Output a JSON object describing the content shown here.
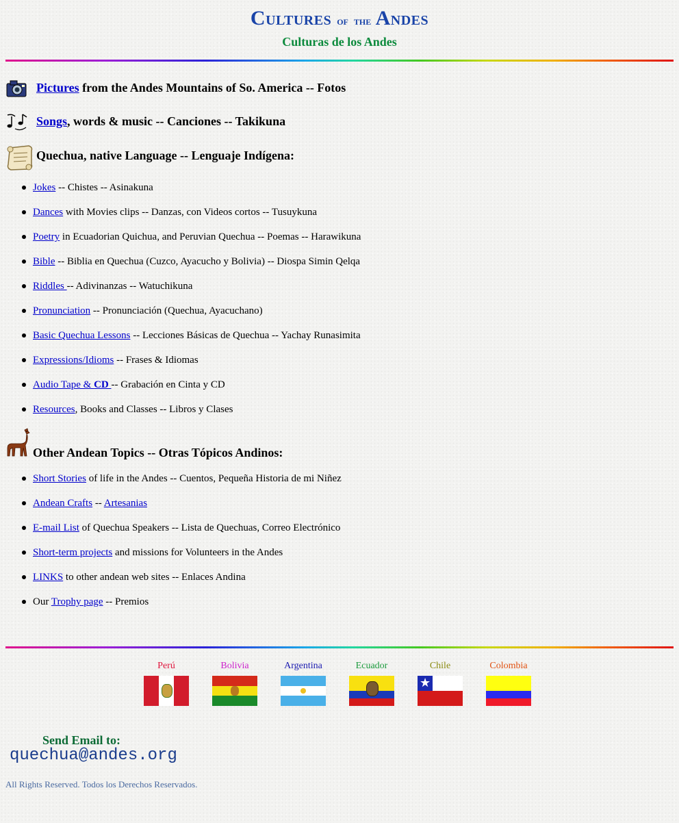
{
  "header": {
    "title_c": "C",
    "title_ultures": "ULTURES",
    "title_of": "OF",
    "title_the": "THE",
    "title_a": "A",
    "title_ndes": "NDES",
    "subtitle": "Culturas de los Andes"
  },
  "main_links": {
    "pictures": {
      "link": "Pictures",
      "text": " from the Andes Mountains of So. America -- Fotos"
    },
    "songs": {
      "link": "Songs",
      "text": ", words & music -- Canciones -- Takikuna"
    },
    "quechua_heading": "Quechua, native Language -- Lenguaje Indígena:"
  },
  "quechua_items": [
    {
      "link": "Jokes",
      "text": " -- Chistes -- Asinakuna"
    },
    {
      "link": "Dances",
      "text": " with Movies clips -- Danzas, con Videos cortos -- Tusuykuna"
    },
    {
      "link": "Poetry",
      "text": " in Ecuadorian Quichua, and Peruvian Quechua -- Poemas -- Harawikuna"
    },
    {
      "link": "Bible",
      "text": " -- Biblia en Quechua (Cuzco, Ayacucho y Bolivia) -- Diospa Simin Qelqa"
    },
    {
      "link": "Riddles ",
      "text": "-- Adivinanzas -- Watuchikuna"
    },
    {
      "link": "Pronunciation",
      "text": " -- Pronunciación (Quechua, Ayacuchano)"
    },
    {
      "link": "Basic Quechua Lessons",
      "text": " -- Lecciones Básicas de Quechua -- Yachay Runasimita"
    },
    {
      "link": "Expressions/Idioms",
      "text": " -- Frases & Idiomas"
    },
    {
      "link": "Audio Tape & ",
      "link_bold": "CD ",
      "text": "-- Grabación en Cinta y CD"
    },
    {
      "link": "Resources",
      "text": ", Books and Classes -- Libros y Clases"
    }
  ],
  "other_heading": "Other Andean Topics -- Otras Tópicos Andinos:",
  "other_items": {
    "stories": {
      "link": "Short Stories",
      "text": " of life in the Andes -- Cuentos, Pequeña Historia de mi Niñez"
    },
    "crafts": {
      "link": "Andean Crafts",
      "sep": " -- ",
      "link2": "Artesanias"
    },
    "email_list": {
      "link": "E-mail List",
      "text": " of Quechua Speakers -- Lista de Quechuas, Correo Electrónico"
    },
    "projects": {
      "link": "Short-term projects",
      "text": " and missions for Volunteers in the Andes"
    },
    "links": {
      "link": "LINKS",
      "text": " to other andean web sites -- Enlaces Andina"
    },
    "trophy": {
      "pre": "Our ",
      "link": "Trophy page",
      "text": " -- Premios"
    }
  },
  "flags": [
    {
      "name": "Perú",
      "color": "#e0143c"
    },
    {
      "name": "Bolivia",
      "color": "#cc22cc"
    },
    {
      "name": "Argentina",
      "color": "#1a1ab0"
    },
    {
      "name": "Ecuador",
      "color": "#1a9a3c"
    },
    {
      "name": "Chile",
      "color": "#8a8a10"
    },
    {
      "name": "Colombia",
      "color": "#e05010"
    }
  ],
  "footer": {
    "send_email_label": "Send Email to:",
    "email": "quechua@andes.org",
    "rights": "All Rights Reserved. Todos los Derechos Reservados."
  }
}
